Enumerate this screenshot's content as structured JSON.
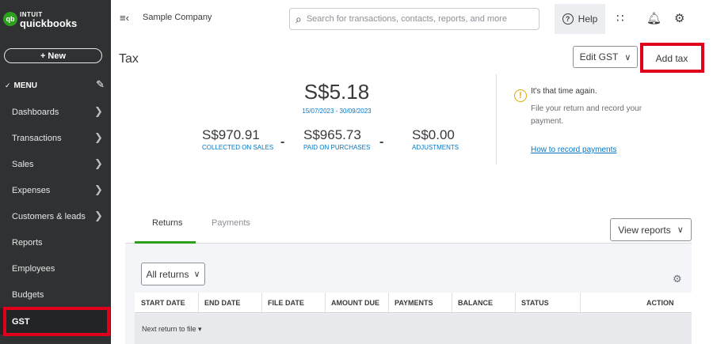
{
  "brand": {
    "line1": "INTUIT",
    "line2": "quickbooks",
    "mark": "qb"
  },
  "sidebar": {
    "new_label": "+ New",
    "menu_label": "MENU",
    "items": [
      {
        "label": "Dashboards",
        "arrow": true
      },
      {
        "label": "Transactions",
        "arrow": true
      },
      {
        "label": "Sales",
        "arrow": true
      },
      {
        "label": "Expenses",
        "arrow": true
      },
      {
        "label": "Customers & leads",
        "arrow": true
      },
      {
        "label": "Reports",
        "arrow": false
      },
      {
        "label": "Employees",
        "arrow": false
      },
      {
        "label": "Budgets",
        "arrow": false
      },
      {
        "label": "GST",
        "arrow": false,
        "active": true
      }
    ]
  },
  "topbar": {
    "company": "Sample Company",
    "search_placeholder": "Search for transactions, contacts, reports, and more",
    "help_label": "Help"
  },
  "page": {
    "title": "Tax",
    "edit_gst_label": "Edit GST",
    "add_tax_label": "Add tax"
  },
  "summary": {
    "total": "S$5.18",
    "period": "15/07/2023 - 30/09/2023",
    "collected_amount": "S$970.91",
    "collected_label": "COLLECTED ON SALES",
    "paid_amount": "S$965.73",
    "paid_label": "PAID ON PURCHASES",
    "adjust_amount": "S$0.00",
    "adjust_label": "ADJUSTMENTS",
    "minus": "-"
  },
  "alert": {
    "icon": "!",
    "title": "It's that time again.",
    "body": "File your return and record your payment.",
    "link": "How to record payments"
  },
  "tabs": {
    "returns": "Returns",
    "payments": "Payments"
  },
  "view_reports_label": "View reports",
  "filter": {
    "selected": "All returns"
  },
  "table": {
    "headers": [
      "START DATE",
      "END DATE",
      "FILE DATE",
      "AMOUNT DUE",
      "PAYMENTS",
      "BALANCE",
      "STATUS",
      "ACTION"
    ],
    "group_label": "Next return to file ▾"
  },
  "colors": {
    "accent": "#2ca01c",
    "link": "#0077c5",
    "highlight": "#e0001b",
    "sidebar": "#2f3133"
  }
}
